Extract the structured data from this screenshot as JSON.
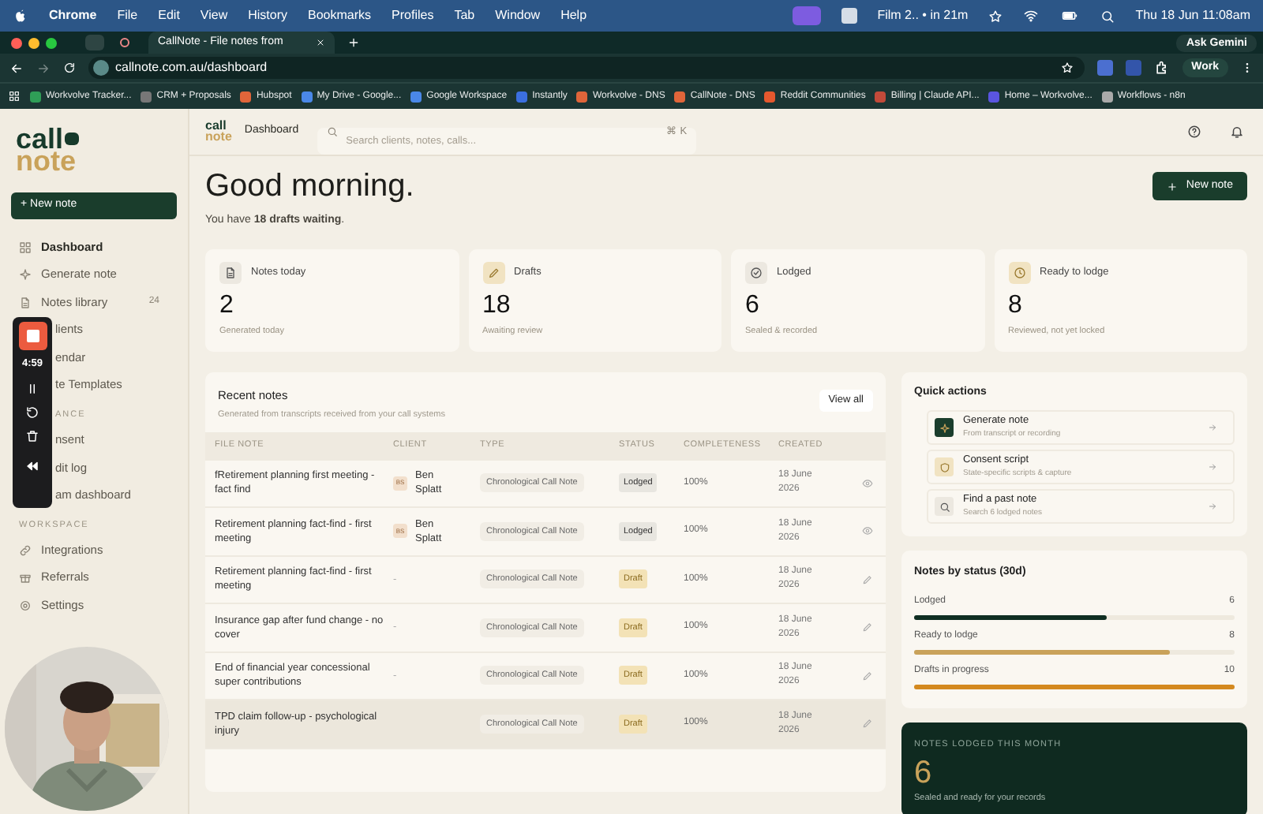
{
  "menu_bar": {
    "app": "Chrome",
    "menus": [
      "File",
      "Edit",
      "View",
      "History",
      "Bookmarks",
      "Profiles",
      "Tab",
      "Window",
      "Help"
    ],
    "event": "Film 2.. • in 21m",
    "clock": "Thu 18 Jun  11:08am"
  },
  "browser": {
    "tab_title": "CallNote - File notes from",
    "ask": "Ask Gemini",
    "url": "callnote.com.au/dashboard",
    "profile": "Work",
    "bookmarks": [
      "Workvolve Tracker...",
      "CRM + Proposals",
      "Hubspot",
      "My Drive - Google...",
      "Google Workspace",
      "Instantly",
      "Workvolve - DNS",
      "CallNote - DNS",
      "Reddit Communities",
      "Billing | Claude API...",
      "Home – Workvolve...",
      "Workflows - n8n"
    ]
  },
  "sidebar": {
    "logo_top": "call",
    "logo_bottom": "note",
    "new_note": "+ New note",
    "items": [
      {
        "kind": "item",
        "label": "Dashboard",
        "selected": true
      },
      {
        "kind": "item",
        "label": "Generate note",
        "selected": false
      },
      {
        "kind": "item",
        "label": "Notes library",
        "badge": "24",
        "selected": false
      },
      {
        "kind": "item",
        "label": "lients",
        "selected": false
      },
      {
        "kind": "item",
        "label": "endar",
        "selected": false
      },
      {
        "kind": "item",
        "label": "te Templates",
        "selected": false
      },
      {
        "kind": "section",
        "label": "ANCE"
      },
      {
        "kind": "item",
        "label": "nsent",
        "selected": false
      },
      {
        "kind": "item",
        "label": "dit log",
        "selected": false
      },
      {
        "kind": "item",
        "label": "am dashboard",
        "selected": false
      },
      {
        "kind": "section",
        "label": "WORKSPACE"
      },
      {
        "kind": "item",
        "label": "Integrations",
        "selected": false
      },
      {
        "kind": "item",
        "label": "Referrals",
        "selected": false
      },
      {
        "kind": "item",
        "label": "Settings",
        "selected": false
      }
    ]
  },
  "recorder": {
    "time": "4:59"
  },
  "header": {
    "logo_top": "call",
    "logo_bottom": "note",
    "breadcrumb": "Dashboard",
    "search_placeholder": "Search clients, notes, calls...",
    "shortcut": "⌘ K"
  },
  "greeting": {
    "title": "Good morning.",
    "subtitle": "You have **18 drafts waiting**.",
    "button": "New note"
  },
  "stats": [
    {
      "label": "Notes today",
      "value": "2",
      "caption": "Generated today"
    },
    {
      "label": "Drafts",
      "value": "18",
      "caption": "Awaiting review"
    },
    {
      "label": "Lodged",
      "value": "6",
      "caption": "Sealed & recorded"
    },
    {
      "label": "Ready to lodge",
      "value": "8",
      "caption": "Reviewed, not yet locked"
    }
  ],
  "recent_notes": {
    "title": "Recent notes",
    "subtitle": "Generated from transcripts received from your call systems",
    "view_all": "View all",
    "columns": [
      "FILE NOTE",
      "CLIENT",
      "TYPE",
      "STATUS",
      "COMPLETENESS",
      "CREATED"
    ],
    "rows": [
      {
        "kind": "lodged",
        "file_note": "fRetirement planning first meeting - fact find",
        "initials": "BS",
        "client": "Ben Splatt",
        "type": "Chronological Call Note",
        "status": "Lodged",
        "completeness": "100%",
        "created": "18 June 2026",
        "highlighted": false
      },
      {
        "kind": "lodged",
        "file_note": "Retirement planning fact-find - first meeting",
        "initials": "BS",
        "client": "Ben Splatt",
        "type": "Chronological Call Note",
        "status": "Lodged",
        "completeness": "100%",
        "created": "18 June 2026",
        "highlighted": false
      },
      {
        "kind": "draft",
        "file_note": "Retirement planning fact-find - first meeting",
        "client": "-",
        "type": "Chronological Call Note",
        "status": "Draft",
        "completeness": "100%",
        "created": "18 June 2026",
        "highlighted": false
      },
      {
        "kind": "draft",
        "file_note": "Insurance gap after fund change - no cover",
        "client": "-",
        "type": "Chronological Call Note",
        "status": "Draft",
        "completeness": "100%",
        "created": "18 June 2026",
        "highlighted": false
      },
      {
        "kind": "draft",
        "file_note": "End of financial year concessional super contributions",
        "client": "-",
        "type": "Chronological Call Note",
        "status": "Draft",
        "completeness": "100%",
        "created": "18 June 2026",
        "highlighted": false
      },
      {
        "kind": "draft",
        "file_note": "TPD claim follow-up - psychological injury",
        "type": "Chronological Call Note",
        "status": "Draft",
        "completeness": "100%",
        "created": "18 June 2026",
        "highlighted": true
      }
    ]
  },
  "quick_actions": {
    "title": "Quick actions",
    "items": [
      {
        "title": "Generate note",
        "subtitle": "From transcript or recording"
      },
      {
        "title": "Consent script",
        "subtitle": "State-specific scripts & capture"
      },
      {
        "title": "Find a past note",
        "subtitle": "Search 6 lodged notes"
      }
    ]
  },
  "notes_by_status": {
    "title": "Notes by status (30d)",
    "items": [
      {
        "label": "Lodged",
        "count": "6",
        "level": 0.6,
        "color": "#0f2e22"
      },
      {
        "label": "Ready to lodge",
        "count": "8",
        "level": 0.8,
        "color": "#c9a25a"
      },
      {
        "label": "Drafts in progress",
        "count": "10",
        "level": 1.0,
        "color": "#d4891f"
      }
    ]
  },
  "month_card": {
    "label": "NOTES LODGED THIS MONTH",
    "value": "6",
    "caption": "Sealed and ready for your records"
  }
}
